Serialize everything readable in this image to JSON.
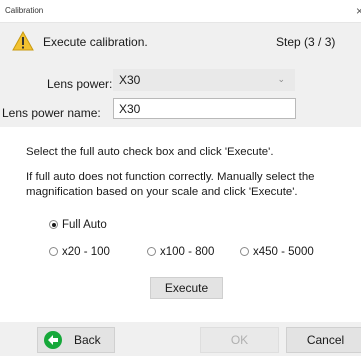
{
  "window": {
    "title": "Calibration"
  },
  "header": {
    "title": "Execute calibration.",
    "step": "Step (3 / 3)",
    "warning_icon": "warning-triangle-icon"
  },
  "lens_power": {
    "label": "Lens power:",
    "value": "X30"
  },
  "lens_power_name": {
    "label": "Lens power name:",
    "value": "X30"
  },
  "instructions": {
    "line1": "Select the full auto check box and click 'Execute'.",
    "line2": "If full auto does not function correctly.  Manually select the magnification based on your scale and click 'Execute'."
  },
  "modes": {
    "full_auto": "Full Auto",
    "options": [
      "x20 - 100",
      "x100 - 800",
      "x450 - 5000"
    ],
    "selected": "Full Auto"
  },
  "buttons": {
    "execute": "Execute",
    "back": "Back",
    "ok": "OK",
    "cancel": "Cancel"
  },
  "colors": {
    "back_arrow": "#16a83a",
    "warning": "#f2c230"
  }
}
